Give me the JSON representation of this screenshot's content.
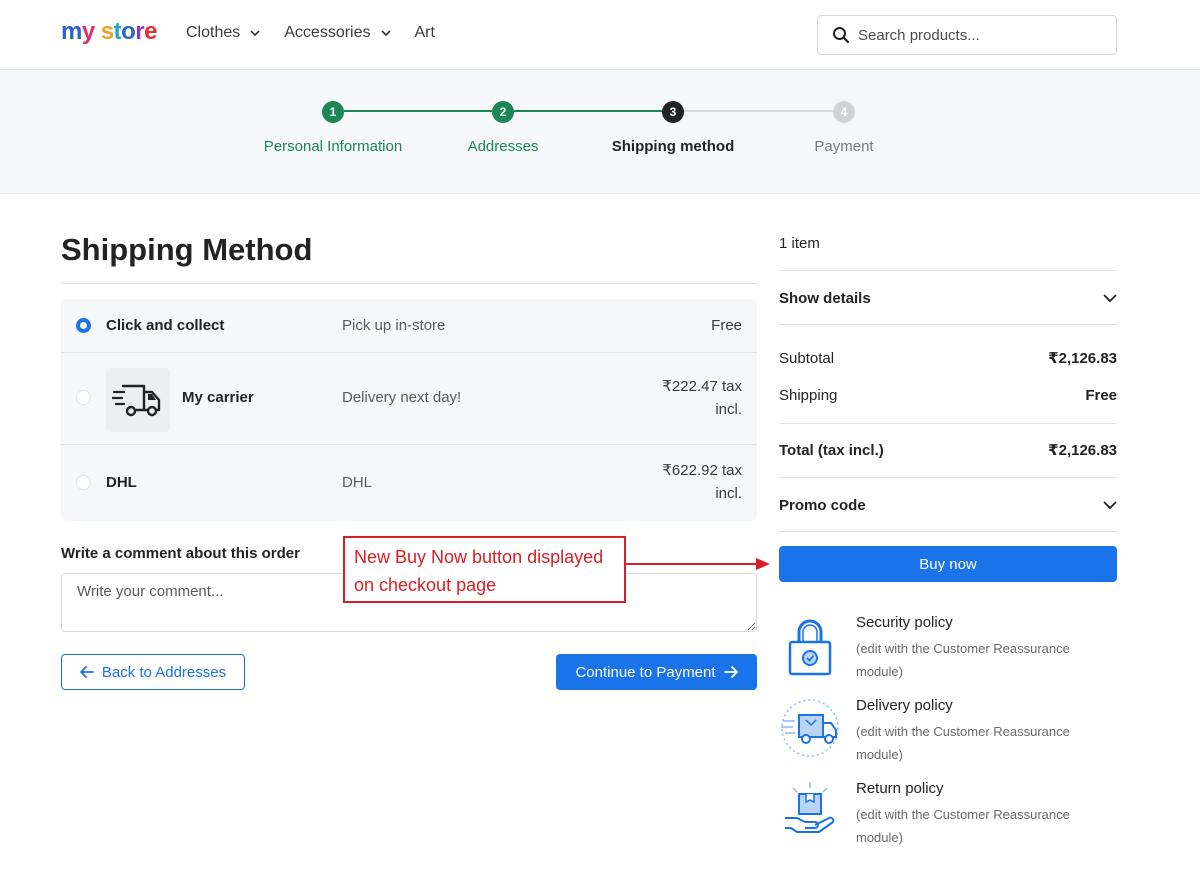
{
  "header": {
    "logo": [
      "m",
      "y",
      " ",
      "s",
      "t",
      "o",
      "r",
      "e"
    ],
    "nav": [
      {
        "label": "Clothes",
        "has_dropdown": true
      },
      {
        "label": "Accessories",
        "has_dropdown": true
      },
      {
        "label": "Art",
        "has_dropdown": false
      }
    ],
    "search": {
      "placeholder": "Search products...",
      "icon": "search-icon"
    }
  },
  "stepper": {
    "steps": [
      {
        "number": "1",
        "label": "Personal Information",
        "state": "complete"
      },
      {
        "number": "2",
        "label": "Addresses",
        "state": "complete"
      },
      {
        "number": "3",
        "label": "Shipping method",
        "state": "current"
      },
      {
        "number": "4",
        "label": "Payment",
        "state": "upcoming"
      }
    ]
  },
  "main": {
    "title": "Shipping Method",
    "options": [
      {
        "name": "Click and collect",
        "description": "Pick up in-store",
        "price": "Free",
        "selected": true
      },
      {
        "name": "My carrier",
        "description": "Delivery next day!",
        "price_line1": "₹222.47 tax",
        "price_line2": "incl.",
        "selected": false,
        "icon": "delivery-truck-icon"
      },
      {
        "name": "DHL",
        "description": "DHL",
        "price_line1": "₹622.92 tax",
        "price_line2": "incl.",
        "selected": false
      }
    ],
    "comment": {
      "label": "Write a comment about this order",
      "placeholder": "Write your comment..."
    },
    "back_button": "Back to Addresses",
    "continue_button": "Continue to Payment"
  },
  "annotation": {
    "line1": "New Buy Now button displayed",
    "line2": "on checkout page"
  },
  "summary": {
    "items_count": "1 item",
    "show_details": "Show details",
    "subtotal_label": "Subtotal",
    "subtotal_value": "₹2,126.83",
    "shipping_label": "Shipping",
    "shipping_value": "Free",
    "total_label": "Total (tax incl.)",
    "total_value": "₹2,126.83",
    "promo_label": "Promo code",
    "buy_button": "Buy now"
  },
  "reassurance": [
    {
      "title": "Security policy",
      "desc": "(edit with the Customer Reassurance module)",
      "icon": "padlock-icon"
    },
    {
      "title": "Delivery policy",
      "desc": "(edit with the Customer Reassurance module)",
      "icon": "delivery-van-icon"
    },
    {
      "title": "Return policy",
      "desc": "(edit with the Customer Reassurance module)",
      "icon": "parcel-hand-icon"
    }
  ],
  "colors": {
    "primary": "#1a73e8",
    "complete": "#1a8754",
    "current": "#232323",
    "upcoming": "#d0d3d6",
    "annotation": "#d81f26"
  }
}
